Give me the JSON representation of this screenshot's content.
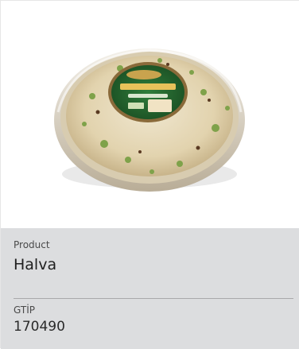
{
  "product": {
    "label": "Product",
    "name": "Halva"
  },
  "gtip": {
    "label": "GTİP",
    "code": "170490"
  },
  "colors": {
    "info_background": "#dcdddf",
    "divider": "#a9a9ab",
    "label_gray": "#4a4a4a"
  }
}
